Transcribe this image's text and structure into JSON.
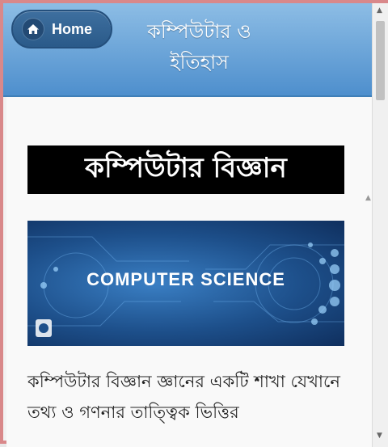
{
  "header": {
    "home_label": "Home",
    "title": "কম্পিউটার ও ইতিহাস"
  },
  "main": {
    "heading": "কম্পিউটার বিজ্ঞান",
    "banner_text": "COMPUTER SCIENCE",
    "paragraph": "কম্পিউটার বিজ্ঞান জ্ঞানের একটি শাখা যেখানে তথ্য ও গণনার তাত্ত্বিক ভিত্তির"
  },
  "colors": {
    "header_top": "#8dbde5",
    "header_bottom": "#4e8fcd",
    "home_button": "#2a5a89"
  },
  "icons": [
    "home-icon",
    "scroll-up-icon",
    "scroll-down-icon"
  ]
}
